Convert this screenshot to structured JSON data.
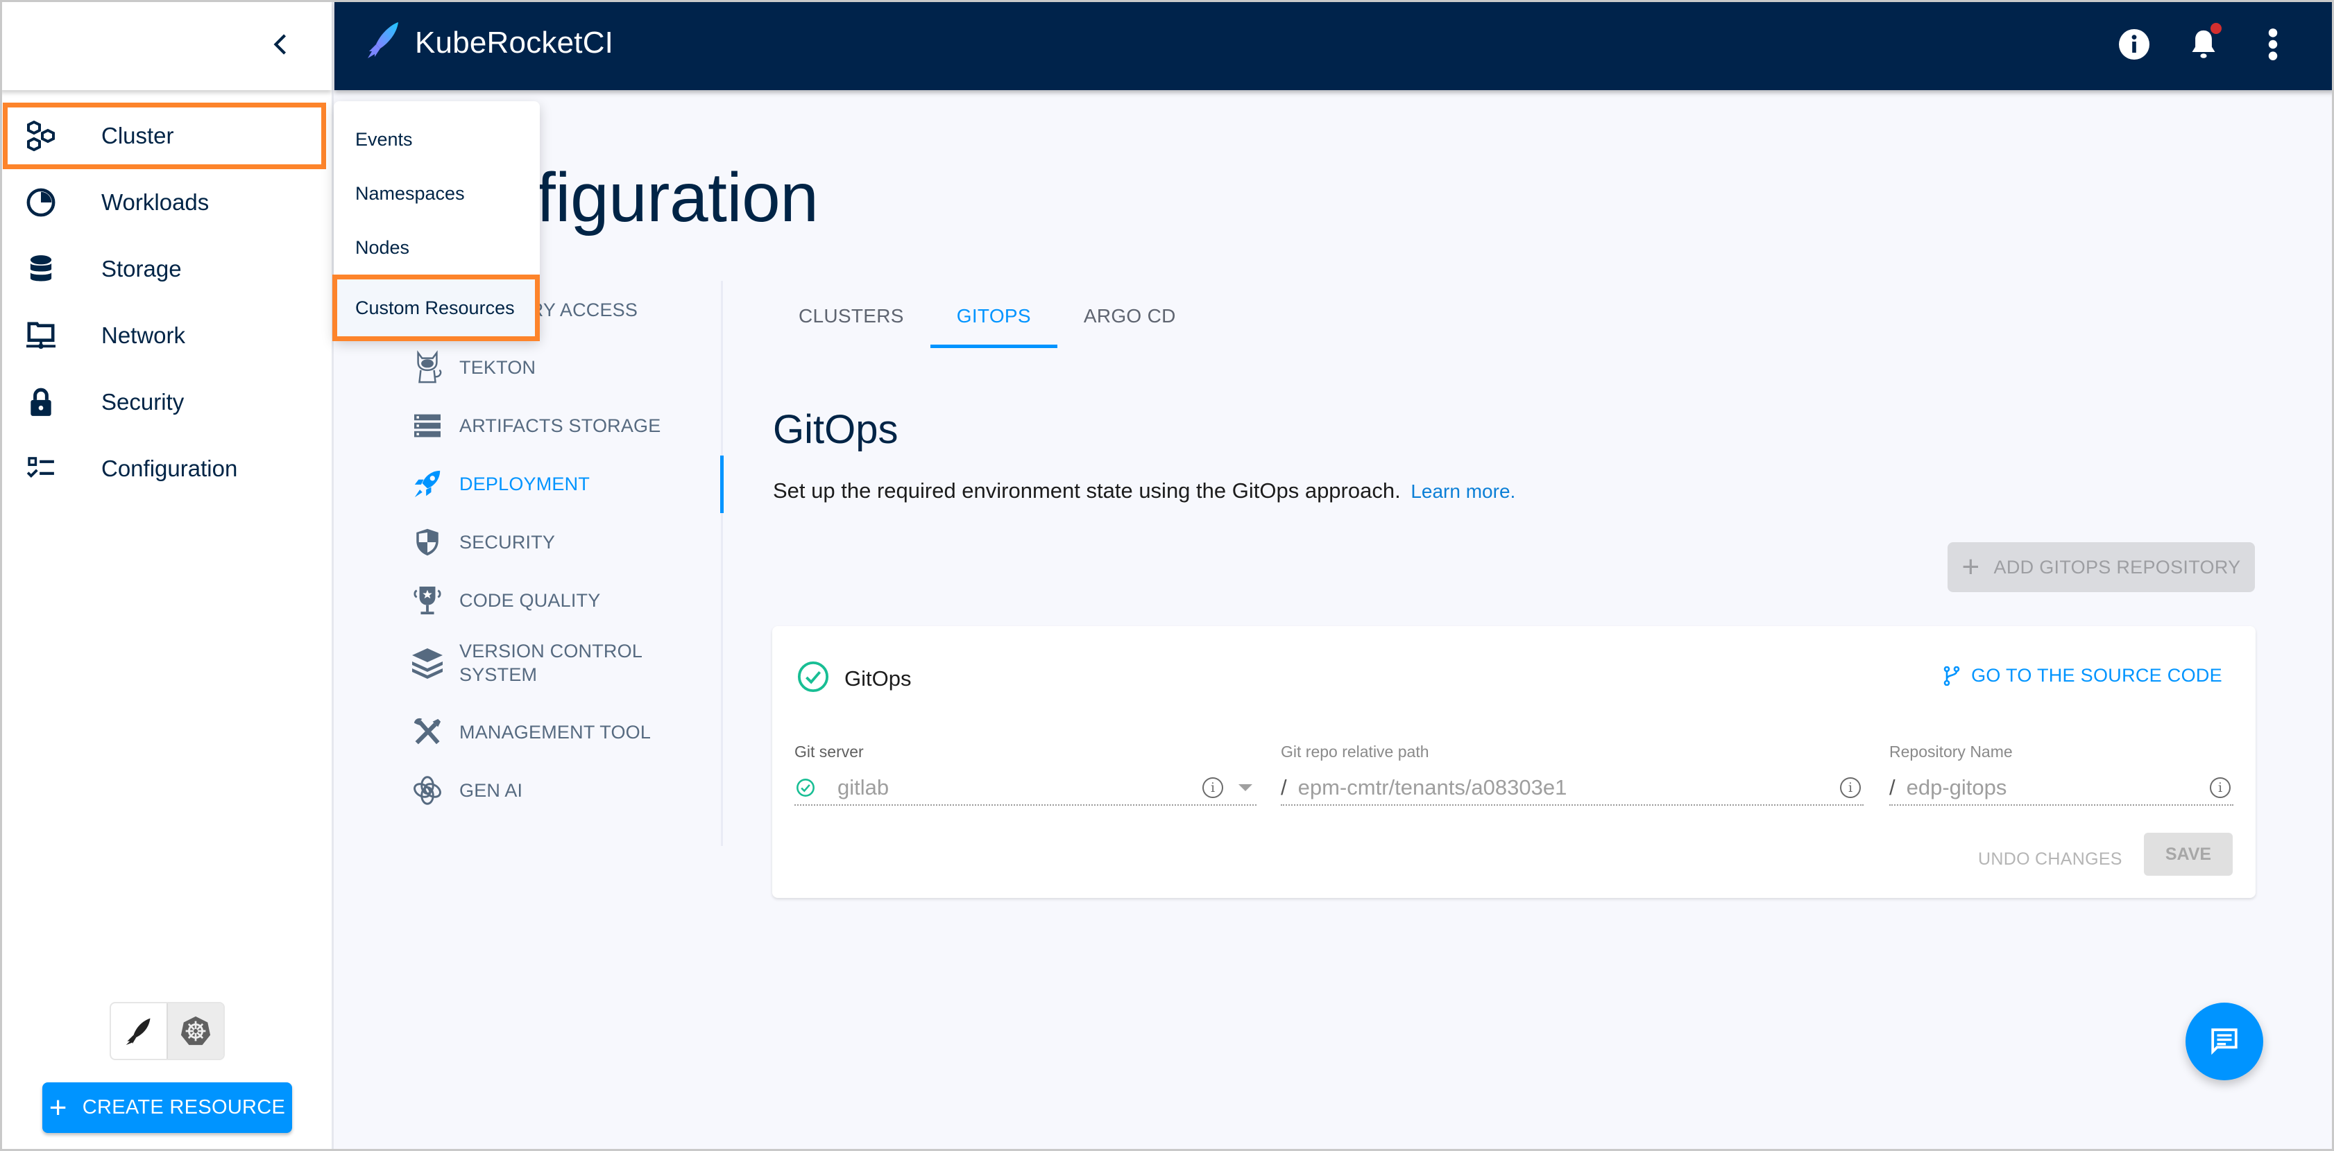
{
  "app": {
    "brand_name": "KubeRocketCI",
    "accent_color": "#0094ff",
    "header_color": "#00234b",
    "highlight_color": "#fd842b"
  },
  "header": {
    "icons": [
      {
        "name": "info-icon"
      },
      {
        "name": "bell-icon",
        "has_badge": true
      },
      {
        "name": "more-vert-icon"
      }
    ]
  },
  "sidebar": {
    "collapse_icon": "chevron-left-icon",
    "items": [
      {
        "label": "Cluster",
        "icon": "cluster-icon",
        "highlighted": true
      },
      {
        "label": "Workloads",
        "icon": "workloads-icon"
      },
      {
        "label": "Storage",
        "icon": "storage-icon"
      },
      {
        "label": "Network",
        "icon": "network-icon"
      },
      {
        "label": "Security",
        "icon": "lock-icon"
      },
      {
        "label": "Configuration",
        "icon": "configuration-icon"
      }
    ],
    "mode_toggle": [
      {
        "name": "kuberocketci-mode",
        "icon": "rocket-icon"
      },
      {
        "name": "kubernetes-mode",
        "icon": "kubernetes-icon",
        "selected": true
      }
    ],
    "create_button": "CREATE RESOURCE"
  },
  "cluster_menu": {
    "items": [
      {
        "label": "Events"
      },
      {
        "label": "Namespaces"
      },
      {
        "label": "Nodes"
      },
      {
        "label": "Custom Resources",
        "highlighted": true
      }
    ]
  },
  "page": {
    "title": "Configuration"
  },
  "config_nav": {
    "items": [
      {
        "label": "REGISTRY ACCESS",
        "visible_label": "CCESS",
        "icon": "registry-icon"
      },
      {
        "label": "TEKTON",
        "icon": "tekton-icon"
      },
      {
        "label": "ARTIFACTS STORAGE",
        "icon": "artifacts-storage-icon"
      },
      {
        "label": "DEPLOYMENT",
        "icon": "rocket-icon",
        "active": true
      },
      {
        "label": "SECURITY",
        "icon": "shield-icon"
      },
      {
        "label": "CODE QUALITY",
        "icon": "trophy-icon"
      },
      {
        "label": "VERSION CONTROL SYSTEM",
        "line1": "VERSION CONTROL",
        "line2": "SYSTEM",
        "icon": "layers-icon"
      },
      {
        "label": "MANAGEMENT TOOL",
        "icon": "tools-icon"
      },
      {
        "label": "GEN AI",
        "icon": "gen-ai-icon"
      }
    ]
  },
  "tabs": [
    {
      "label": "CLUSTERS"
    },
    {
      "label": "GITOPS",
      "active": true
    },
    {
      "label": "ARGO CD"
    }
  ],
  "gitops": {
    "title": "GitOps",
    "description": "Set up the required environment state using the GitOps approach.",
    "learn_more": "Learn more.",
    "add_button": "ADD GITOPS REPOSITORY",
    "card": {
      "title": "GitOps",
      "status": "success",
      "source_link": "GO TO THE SOURCE CODE",
      "fields": {
        "git_server": {
          "label": "Git server",
          "value": "gitlab"
        },
        "repo_path": {
          "label": "Git repo relative path",
          "prefix": "/",
          "value": "epm-cmtr/tenants/a08303e1"
        },
        "repo_name": {
          "label": "Repository Name",
          "prefix": "/",
          "value": "edp-gitops"
        }
      },
      "undo_button": "UNDO CHANGES",
      "save_button": "SAVE"
    }
  },
  "fab": {
    "icon": "chat-icon"
  }
}
